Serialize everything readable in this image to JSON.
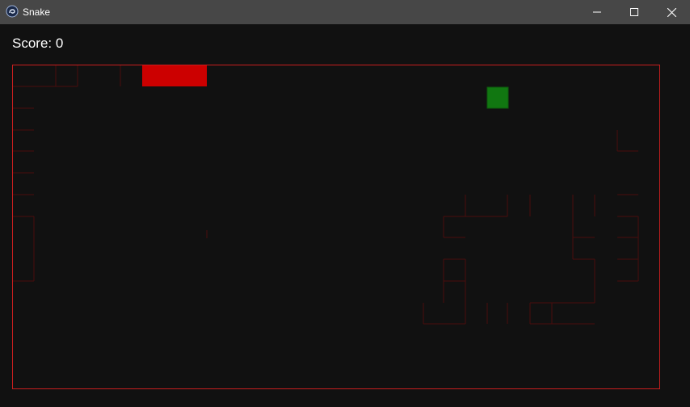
{
  "window": {
    "title": "Snake",
    "app_icon": "snake-app-icon",
    "controls": {
      "minimize_icon": "minimize-icon",
      "maximize_icon": "maximize-icon",
      "close_icon": "close-icon"
    }
  },
  "hud": {
    "score_label": "Score: 0"
  },
  "board": {
    "border_color": "#c81e1e",
    "background": "#111111",
    "snake_color": "#cc0000",
    "food_color": "#117711",
    "trail_color": "#4a0d0d"
  }
}
